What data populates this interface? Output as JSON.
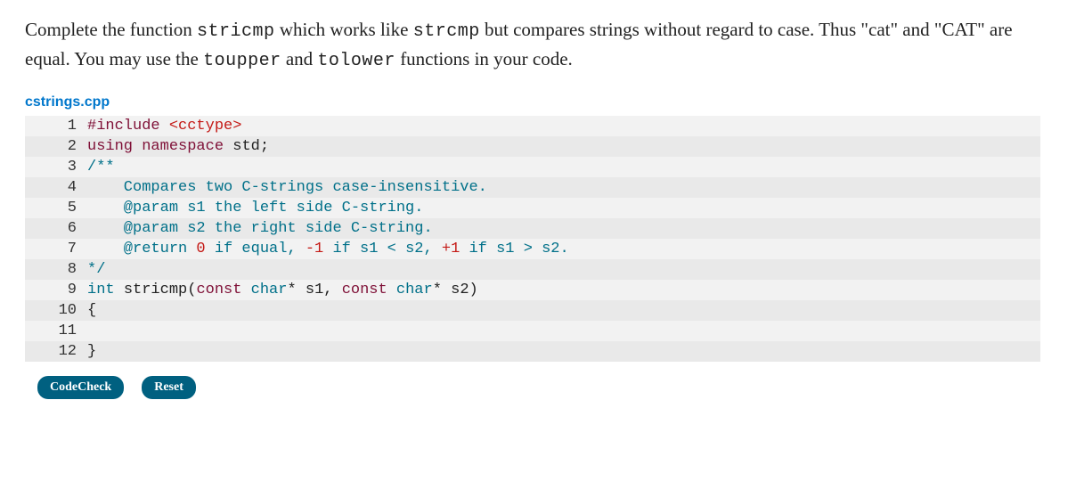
{
  "prompt": {
    "parts": [
      {
        "t": "Complete the function ",
        "mono": false
      },
      {
        "t": "stricmp",
        "mono": true
      },
      {
        "t": " which works like ",
        "mono": false
      },
      {
        "t": "strcmp",
        "mono": true
      },
      {
        "t": " but compares strings without regard to case. Thus \"cat\" and \"CAT\" are equal. You may use the ",
        "mono": false
      },
      {
        "t": "toupper",
        "mono": true
      },
      {
        "t": " and ",
        "mono": false
      },
      {
        "t": "tolower",
        "mono": true
      },
      {
        "t": " functions in your code.",
        "mono": false
      }
    ]
  },
  "filename": "cstrings.cpp",
  "buttons": {
    "codecheck": "CodeCheck",
    "reset": "Reset"
  },
  "code": {
    "lines": [
      {
        "n": "1",
        "segs": [
          {
            "txt": "#include ",
            "cls": "tok-pp"
          },
          {
            "txt": "<cctype>",
            "cls": "tok-angle"
          }
        ]
      },
      {
        "n": "2",
        "segs": [
          {
            "txt": "using ",
            "cls": "tok-kw"
          },
          {
            "txt": "namespace ",
            "cls": "tok-kw"
          },
          {
            "txt": "std;",
            "cls": "tok-std"
          }
        ]
      },
      {
        "n": "3",
        "segs": [
          {
            "txt": "/**",
            "cls": "tok-comment"
          }
        ]
      },
      {
        "n": "4",
        "segs": [
          {
            "txt": "    Compares two C-strings case-insensitive.",
            "cls": "tok-comment"
          }
        ]
      },
      {
        "n": "5",
        "segs": [
          {
            "txt": "    @param s1 the left side C-string.",
            "cls": "tok-comment"
          }
        ]
      },
      {
        "n": "6",
        "segs": [
          {
            "txt": "    @param s2 the right side C-string.",
            "cls": "tok-comment"
          }
        ]
      },
      {
        "n": "7",
        "segs": [
          {
            "txt": "    @return ",
            "cls": "tok-comment"
          },
          {
            "txt": "0",
            "cls": "tok-num"
          },
          {
            "txt": " if equal, ",
            "cls": "tok-comment"
          },
          {
            "txt": "-1",
            "cls": "tok-num"
          },
          {
            "txt": " if s1 < s2, ",
            "cls": "tok-comment"
          },
          {
            "txt": "+1",
            "cls": "tok-num"
          },
          {
            "txt": " if s1 > s2.",
            "cls": "tok-comment"
          }
        ]
      },
      {
        "n": "8",
        "segs": [
          {
            "txt": "*/",
            "cls": "tok-comment"
          }
        ]
      },
      {
        "n": "9",
        "segs": [
          {
            "txt": "int ",
            "cls": "tok-type"
          },
          {
            "txt": "stricmp(",
            "cls": "tok-ident"
          },
          {
            "txt": "const ",
            "cls": "tok-kw"
          },
          {
            "txt": "char",
            "cls": "tok-type"
          },
          {
            "txt": "* s1, ",
            "cls": "tok-ident"
          },
          {
            "txt": "const ",
            "cls": "tok-kw"
          },
          {
            "txt": "char",
            "cls": "tok-type"
          },
          {
            "txt": "* s2)",
            "cls": "tok-ident"
          }
        ]
      },
      {
        "n": "10",
        "segs": [
          {
            "txt": "{",
            "cls": "tok-ident"
          }
        ]
      },
      {
        "n": "11",
        "segs": [
          {
            "txt": "",
            "cls": "tok-ident"
          }
        ]
      },
      {
        "n": "12",
        "segs": [
          {
            "txt": "}",
            "cls": "tok-ident"
          }
        ]
      }
    ]
  }
}
